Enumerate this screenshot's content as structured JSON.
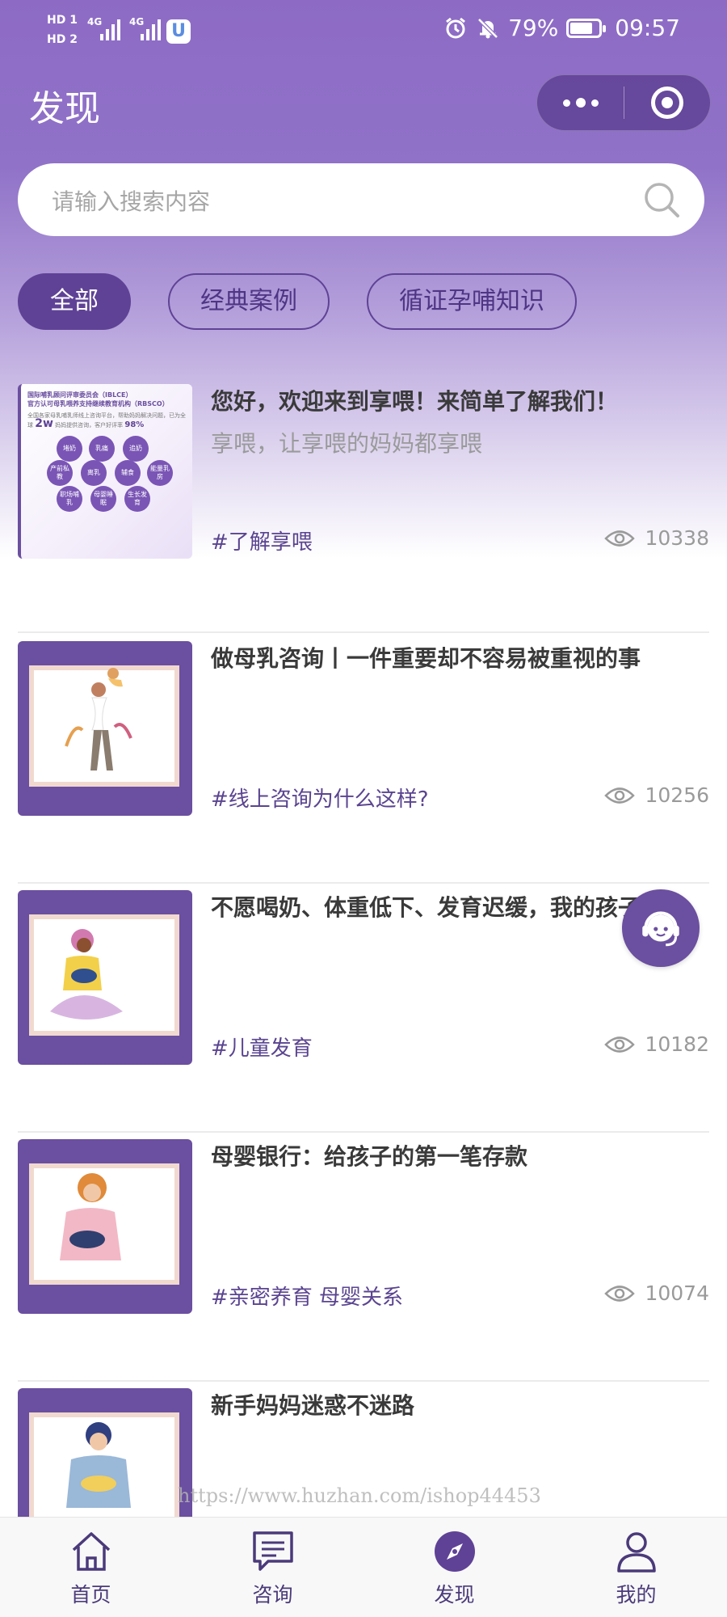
{
  "status_bar": {
    "hd1": "HD 1",
    "hd2": "HD 2",
    "signal1": "4G",
    "signal2": "4G",
    "battery": "79%",
    "battery_level": 0.79,
    "time": "09:57"
  },
  "header": {
    "title": "发现"
  },
  "search": {
    "placeholder": "请输入搜索内容"
  },
  "tabs": [
    {
      "label": "全部",
      "active": true
    },
    {
      "label": "经典案例",
      "active": false
    },
    {
      "label": "循证孕哺知识",
      "active": false
    }
  ],
  "articles": [
    {
      "title": "您好，欢迎来到享喂！来简单了解我们！",
      "subtitle": "享喂，让享喂的妈妈都享喂",
      "tag": "#了解享喂",
      "views": "10338",
      "thumb_text": {
        "line1": "国际哺乳顾问评审委员会（IBLCE）",
        "line2": "官方认可母乳喂养支持继续教育机构（RBSCO）",
        "line3": "全国各家母乳哺乳师线上咨询平台，帮助妈妈解决问题，已为全球",
        "big": "2w",
        "line4": "妈妈提供咨询，客户好评率",
        "pct": "98%",
        "bubbles": [
          "堵奶",
          "乳痛",
          "追奶",
          "产前私教",
          "离乳",
          "辅食",
          "能量乳房",
          "职场哺乳",
          "母婴睡眠",
          "生长发育"
        ]
      }
    },
    {
      "title": "做母乳咨询丨一件重要却不容易被重视的事",
      "subtitle": "",
      "tag": "#线上咨询为什么这样?",
      "views": "10256"
    },
    {
      "title": "不愿喝奶、体重低下、发育迟缓，我的孩子…",
      "subtitle": "",
      "tag": "#儿童发育",
      "views": "10182"
    },
    {
      "title": "母婴银行：给孩子的第一笔存款",
      "subtitle": "",
      "tag": "#亲密养育 母婴关系",
      "views": "10074"
    },
    {
      "title": "新手妈妈迷惑不迷路",
      "subtitle": "",
      "tag": "",
      "views": ""
    }
  ],
  "watermark": "https://www.huzhan.com/ishop44453",
  "tabbar": [
    {
      "label": "首页",
      "icon": "home-icon"
    },
    {
      "label": "咨询",
      "icon": "chat-icon"
    },
    {
      "label": "发现",
      "icon": "compass-icon",
      "active": true
    },
    {
      "label": "我的",
      "icon": "user-icon"
    }
  ],
  "colors": {
    "brand": "#5f4296",
    "header_bg": "#8d6bc5",
    "tag_text": "#5a4490"
  }
}
